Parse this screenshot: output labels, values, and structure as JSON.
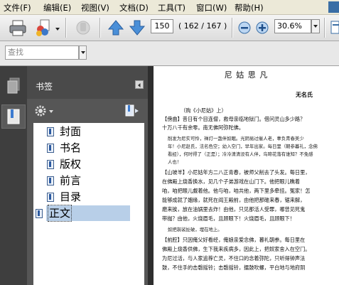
{
  "menu": [
    "文件(F)",
    "编辑(E)",
    "视图(V)",
    "文档(D)",
    "工具(T)",
    "窗口(W)",
    "帮助(H)"
  ],
  "toolbar": {
    "page_current": "150",
    "page_info": "( 162 / 167 )",
    "zoom": "30.6%"
  },
  "search": {
    "placeholder": "查找"
  },
  "bookmarks": {
    "title": "书签",
    "items": [
      "封面",
      "书名",
      "版权",
      "前言",
      "目录",
      "正文"
    ],
    "selected_index": 5
  },
  "document": {
    "title": "尼 姑 思 凡",
    "author": "无名氏",
    "lines": [
      "（购《小尼姑》上）",
      "【傍曲】昔日有个目连僧，救母亲临地狱门。借问灵山多少路？",
      "十万八千有余零。南无佛阿弥陀佛。",
      "削发为尼实可怜，禅灯一盏伴奴眠。光阴易过催人老，辜负青春美少",
      "年！小尼赵氏，法名色空；幼入空门，早年出家。每日里（朝参暮礼，念佛",
      "看经），何时得了（正是）；冷冷清清没有人伴，鸟啼花落有谁知？不免感",
      "人也！",
      "【山坡羊】小尼姑年方二八正青春，被师父削去了头发。每日里，",
      "在佛殿上烧香换水，见几个子弟游戏在山门下。他把眼儿瞧着",
      "咱，咱把眼儿觑着他。他与咱，咱共他，两下里多牵挂。冤家！怎",
      "能够成就了姻缘，就死在阎王殿前，由他把那碓来春，锯来解，",
      "磨来挨，放在油锅里去炸！由他，只见那活人受罪，哪曾见死鬼",
      "带枷？由他，火烧眉毛，且顾眼下！火烧眉毛，且顾眼下！",
      "奴把袈裟扯破，埋在地上。",
      "【前腔】只因俺父好看经，俺娘亲爱念佛，暮礼朝参。每日里在",
      "佛殿上烧香供佛，生下我来疾病多，因此上，把奴家舍入在空门。",
      "为尼过活，与人家追荐亡灵，不住口的念着弥陀，只听得钟声法",
      "鼓，不住手的击磬摇铃；击磬摇铃，擂鼓吹螺，平白地与地府阴"
    ]
  }
}
